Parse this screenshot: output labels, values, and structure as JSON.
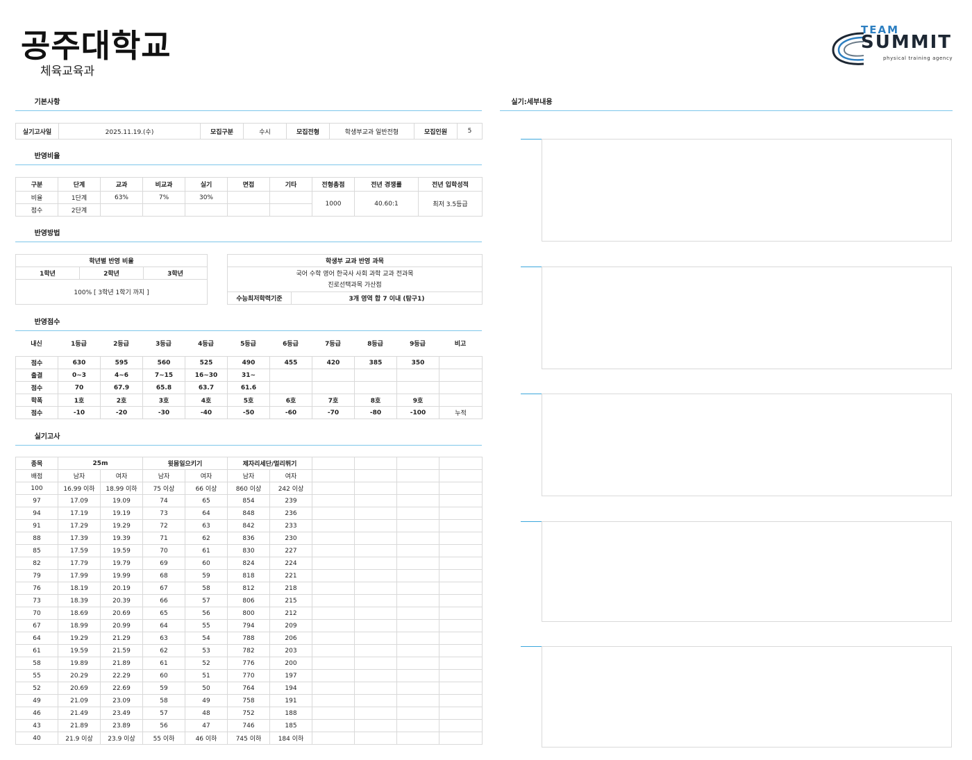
{
  "header": {
    "university": "공주대학교",
    "department": "체육교육과",
    "logo_top": "TEAM",
    "logo_main": "SUMMIT",
    "logo_tagline": "physical training agency"
  },
  "sections": {
    "basic": "기본사항",
    "ratio": "반영비율",
    "method": "반영방법",
    "score": "반영점수",
    "practical": "실기고사",
    "detail": "실기:세부내용"
  },
  "basic": {
    "exam_date_label": "실기고사일",
    "exam_date": "2025.11.19.(수)",
    "type_label": "모집구분",
    "type": "수시",
    "track_label": "모집전형",
    "track": "학생부교과 일반전형",
    "quota_label": "모집인원",
    "quota": "5"
  },
  "ratio": {
    "headers": [
      "구분",
      "단계",
      "교과",
      "비교과",
      "실기",
      "면접",
      "기타",
      "전형총점",
      "전년 경쟁률",
      "전년 입학성적"
    ],
    "row1": [
      "비율",
      "1단계",
      "63%",
      "7%",
      "30%",
      "",
      ""
    ],
    "row2": [
      "점수",
      "2단계",
      "",
      "",
      "",
      "",
      ""
    ],
    "total": "1000",
    "competition": "40.60:1",
    "prev_grade": "최저 3.5등급"
  },
  "method": {
    "year_title": "학년별 반영 비율",
    "years": [
      "1학년",
      "2학년",
      "3학년"
    ],
    "year_value": "100% [ 3학년 1학기 까지 ]",
    "subject_title": "학생부 교과 반영 과목",
    "subject_line1": "국어 수학 영어 한국사 사회 과학 교과 전과목",
    "subject_line2": "진로선택과목 가산점",
    "min_label": "수능최저학력기준",
    "min_value": "3개 영역 합 7 이내 (탐구1)"
  },
  "score": {
    "headers": [
      "내신",
      "1등급",
      "2등급",
      "3등급",
      "4등급",
      "5등급",
      "6등급",
      "7등급",
      "8등급",
      "9등급",
      "비고"
    ],
    "rows": [
      [
        "점수",
        "630",
        "595",
        "560",
        "525",
        "490",
        "455",
        "420",
        "385",
        "350",
        ""
      ],
      [
        "출결",
        "0~3",
        "4~6",
        "7~15",
        "16~30",
        "31~",
        "",
        "",
        "",
        "",
        ""
      ],
      [
        "점수",
        "70",
        "67.9",
        "65.8",
        "63.7",
        "61.6",
        "",
        "",
        "",
        "",
        ""
      ],
      [
        "학폭",
        "1호",
        "2호",
        "3호",
        "4호",
        "5호",
        "6호",
        "7호",
        "8호",
        "9호",
        ""
      ],
      [
        "점수",
        "-10",
        "-20",
        "-30",
        "-40",
        "-50",
        "-60",
        "-70",
        "-80",
        "-100",
        "누적"
      ]
    ]
  },
  "practical": {
    "col_event": "종목",
    "events": [
      "25m",
      "윗몸일으키기",
      "제자리세단/멀리뛰기"
    ],
    "sub_label": "배점",
    "genders": [
      "남자",
      "여자",
      "남자",
      "여자",
      "남자",
      "여자"
    ],
    "rows": [
      [
        "100",
        "16.99 이하",
        "18.99 이하",
        "75 이상",
        "66 이상",
        "860 이상",
        "242 이상"
      ],
      [
        "97",
        "17.09",
        "19.09",
        "74",
        "65",
        "854",
        "239"
      ],
      [
        "94",
        "17.19",
        "19.19",
        "73",
        "64",
        "848",
        "236"
      ],
      [
        "91",
        "17.29",
        "19.29",
        "72",
        "63",
        "842",
        "233"
      ],
      [
        "88",
        "17.39",
        "19.39",
        "71",
        "62",
        "836",
        "230"
      ],
      [
        "85",
        "17.59",
        "19.59",
        "70",
        "61",
        "830",
        "227"
      ],
      [
        "82",
        "17.79",
        "19.79",
        "69",
        "60",
        "824",
        "224"
      ],
      [
        "79",
        "17.99",
        "19.99",
        "68",
        "59",
        "818",
        "221"
      ],
      [
        "76",
        "18.19",
        "20.19",
        "67",
        "58",
        "812",
        "218"
      ],
      [
        "73",
        "18.39",
        "20.39",
        "66",
        "57",
        "806",
        "215"
      ],
      [
        "70",
        "18.69",
        "20.69",
        "65",
        "56",
        "800",
        "212"
      ],
      [
        "67",
        "18.99",
        "20.99",
        "64",
        "55",
        "794",
        "209"
      ],
      [
        "64",
        "19.29",
        "21.29",
        "63",
        "54",
        "788",
        "206"
      ],
      [
        "61",
        "19.59",
        "21.59",
        "62",
        "53",
        "782",
        "203"
      ],
      [
        "58",
        "19.89",
        "21.89",
        "61",
        "52",
        "776",
        "200"
      ],
      [
        "55",
        "20.29",
        "22.29",
        "60",
        "51",
        "770",
        "197"
      ],
      [
        "52",
        "20.69",
        "22.69",
        "59",
        "50",
        "764",
        "194"
      ],
      [
        "49",
        "21.09",
        "23.09",
        "58",
        "49",
        "758",
        "191"
      ],
      [
        "46",
        "21.49",
        "23.49",
        "57",
        "48",
        "752",
        "188"
      ],
      [
        "43",
        "21.89",
        "23.89",
        "56",
        "47",
        "746",
        "185"
      ],
      [
        "40",
        "21.9 이상",
        "23.9 이상",
        "55 이하",
        "46 이하",
        "745 이하",
        "184 이하"
      ]
    ]
  },
  "colors": {
    "accent": "#3aa6dc",
    "border": "#d9d9d9",
    "logo_blue": "#2d7fc1"
  }
}
